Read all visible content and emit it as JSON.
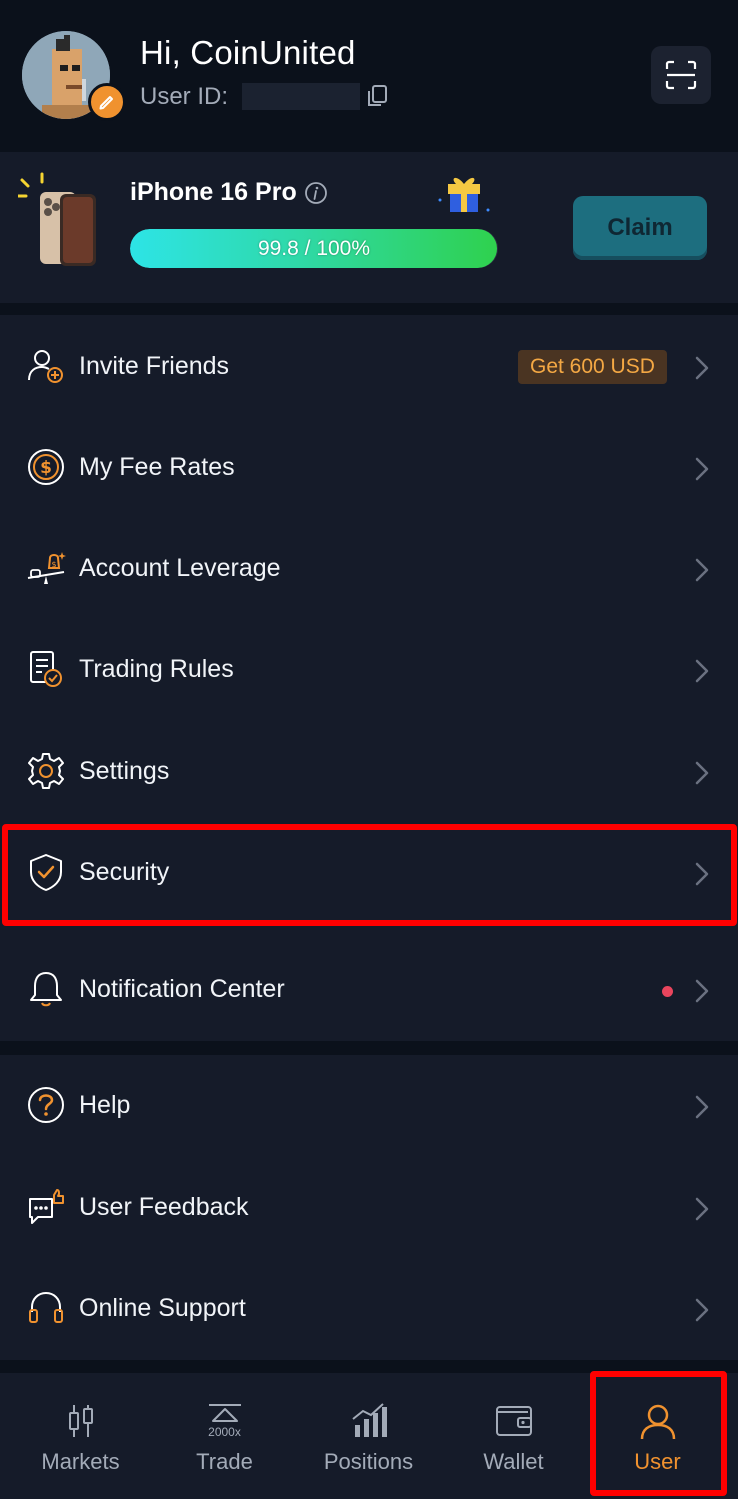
{
  "header": {
    "greeting": "Hi, CoinUnited",
    "user_id_label": "User ID:",
    "user_id_value": ""
  },
  "promo": {
    "title": "iPhone 16 Pro",
    "progress_text": "99.8 / 100%",
    "progress_value": 99.8,
    "claim_label": "Claim"
  },
  "menu": {
    "group1": [
      {
        "label": "Invite Friends",
        "badge": "Get 600 USD",
        "icon": "invite-user-icon"
      },
      {
        "label": "My Fee Rates",
        "icon": "dollar-coin-icon"
      },
      {
        "label": "Account Leverage",
        "icon": "leverage-scale-icon"
      },
      {
        "label": "Trading Rules",
        "icon": "document-check-icon"
      },
      {
        "label": "Settings",
        "icon": "gear-icon"
      },
      {
        "label": "Security",
        "icon": "shield-check-icon"
      }
    ],
    "group2": [
      {
        "label": "Notification Center",
        "icon": "bell-icon",
        "has_unread": true
      }
    ],
    "group3": [
      {
        "label": "Help",
        "icon": "question-icon"
      },
      {
        "label": "User Feedback",
        "icon": "feedback-icon"
      },
      {
        "label": "Online Support",
        "icon": "headset-icon"
      }
    ]
  },
  "bottom_nav": {
    "items": [
      {
        "label": "Markets",
        "icon": "candlestick-icon"
      },
      {
        "label": "Trade",
        "icon": "trade-icon",
        "sub": "2000x"
      },
      {
        "label": "Positions",
        "icon": "bar-chart-icon"
      },
      {
        "label": "Wallet",
        "icon": "wallet-icon"
      },
      {
        "label": "User",
        "icon": "user-icon",
        "active": true
      }
    ]
  },
  "colors": {
    "accent": "#f0922f",
    "background": "#0b111b",
    "card": "#151b29",
    "highlight": "#ff0000",
    "unread_dot": "#e9455d"
  }
}
